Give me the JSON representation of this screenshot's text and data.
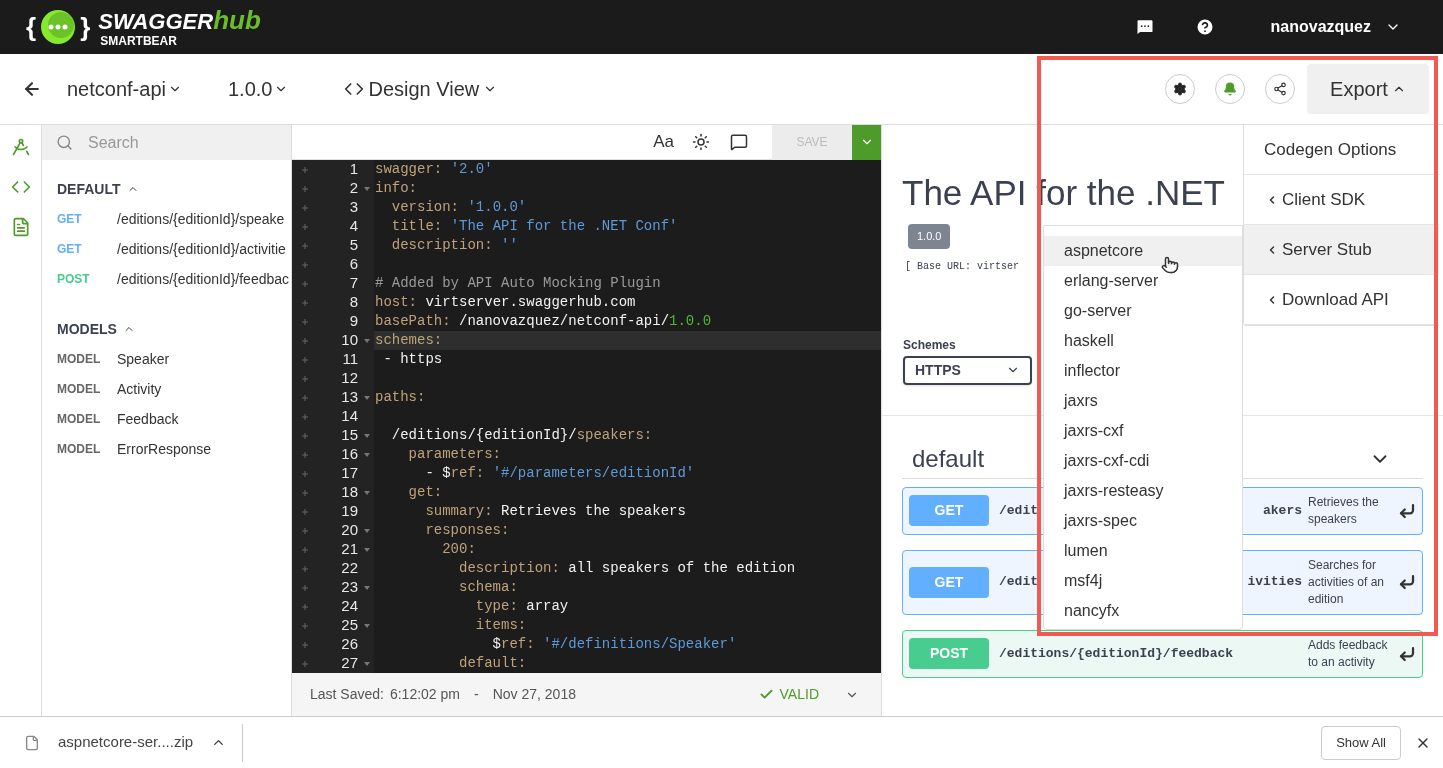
{
  "header": {
    "logo": {
      "open": "{",
      "close": "}",
      "word": "SWAGGER",
      "accent": "hub",
      "sub": "SMARTBEAR"
    },
    "user": "nanovazquez"
  },
  "toolbar": {
    "api": "netconf-api",
    "version": "1.0.0",
    "view": "Design View",
    "export": "Export"
  },
  "sidebar": {
    "search": {
      "placeholder": "Search"
    },
    "sections": [
      {
        "title": "DEFAULT",
        "expanded": true,
        "items": [
          {
            "kind": "get",
            "tag": "GET",
            "text": "/editions/{editionId}/speake"
          },
          {
            "kind": "get",
            "tag": "GET",
            "text": "/editions/{editionId}/activitie"
          },
          {
            "kind": "post",
            "tag": "POST",
            "text": "/editions/{editionId}/feedbac"
          }
        ]
      },
      {
        "title": "MODELS",
        "expanded": true,
        "items": [
          {
            "kind": "model",
            "tag": "MODEL",
            "text": "Speaker"
          },
          {
            "kind": "model",
            "tag": "MODEL",
            "text": "Activity"
          },
          {
            "kind": "model",
            "tag": "MODEL",
            "text": "Feedback"
          },
          {
            "kind": "model",
            "tag": "MODEL",
            "text": "ErrorResponse"
          }
        ]
      }
    ]
  },
  "editor": {
    "font_button": "Aa",
    "save": {
      "label": "SAVE",
      "disabled": true
    },
    "lines": [
      {
        "num": "1",
        "foldable": false,
        "active": false,
        "tokens": [
          {
            "kind": "key",
            "text": "swagger: "
          },
          {
            "kind": "string",
            "text": "'2.0'"
          }
        ]
      },
      {
        "num": "2",
        "foldable": true,
        "active": false,
        "tokens": [
          {
            "kind": "key",
            "text": "info:"
          }
        ]
      },
      {
        "num": "3",
        "foldable": false,
        "active": false,
        "tokens": [
          {
            "kind": "key",
            "text": "  version: "
          },
          {
            "kind": "string",
            "text": "'1.0.0'"
          }
        ]
      },
      {
        "num": "4",
        "foldable": false,
        "active": false,
        "tokens": [
          {
            "kind": "key",
            "text": "  title: "
          },
          {
            "kind": "string",
            "text": "'The API for the .NET Conf'"
          }
        ]
      },
      {
        "num": "5",
        "foldable": false,
        "active": false,
        "tokens": [
          {
            "kind": "key",
            "text": "  description: "
          },
          {
            "kind": "string",
            "text": "''"
          }
        ]
      },
      {
        "num": "6",
        "foldable": false,
        "active": false
      },
      {
        "num": "7",
        "foldable": false,
        "active": false,
        "tokens": [
          {
            "kind": "comment",
            "text": "# Added by API Auto Mocking Plugin"
          }
        ]
      },
      {
        "num": "8",
        "foldable": false,
        "active": false,
        "tokens": [
          {
            "kind": "key",
            "text": "host: "
          },
          {
            "kind": "plain",
            "text": "virtserver.swaggerhub.com"
          }
        ]
      },
      {
        "num": "9",
        "foldable": false,
        "active": false,
        "tokens": [
          {
            "kind": "key",
            "text": "basePath: "
          },
          {
            "kind": "plain",
            "text": "/nanovazquez/netconf-api/"
          },
          {
            "kind": "number",
            "text": "1.0.0"
          }
        ]
      },
      {
        "num": "10",
        "foldable": true,
        "active": true,
        "tokens": [
          {
            "kind": "key",
            "text": "schemes:"
          }
        ]
      },
      {
        "num": "11",
        "foldable": false,
        "active": false,
        "tokens": [
          {
            "kind": "plain",
            "text": " - https"
          }
        ]
      },
      {
        "num": "12",
        "foldable": false,
        "active": false
      },
      {
        "num": "13",
        "foldable": true,
        "active": false,
        "tokens": [
          {
            "kind": "key",
            "text": "paths:"
          }
        ]
      },
      {
        "num": "14",
        "foldable": false,
        "active": false
      },
      {
        "num": "15",
        "foldable": true,
        "active": false,
        "tokens": [
          {
            "kind": "plain",
            "text": "  /editions/{editionId}/"
          },
          {
            "kind": "key",
            "text": "speakers:"
          }
        ]
      },
      {
        "num": "16",
        "foldable": true,
        "active": false,
        "tokens": [
          {
            "kind": "key",
            "text": "    parameters:"
          }
        ]
      },
      {
        "num": "17",
        "foldable": false,
        "active": false,
        "tokens": [
          {
            "kind": "plain",
            "text": "      - $"
          },
          {
            "kind": "key",
            "text": "ref: "
          },
          {
            "kind": "string",
            "text": "'#/parameters/editionId'"
          }
        ]
      },
      {
        "num": "18",
        "foldable": true,
        "active": false,
        "tokens": [
          {
            "kind": "key",
            "text": "    get:"
          }
        ]
      },
      {
        "num": "19",
        "foldable": false,
        "active": false,
        "tokens": [
          {
            "kind": "key",
            "text": "      summary: "
          },
          {
            "kind": "plain",
            "text": "Retrieves the speakers"
          }
        ]
      },
      {
        "num": "20",
        "foldable": true,
        "active": false,
        "tokens": [
          {
            "kind": "key",
            "text": "      responses:"
          }
        ]
      },
      {
        "num": "21",
        "foldable": true,
        "active": false,
        "tokens": [
          {
            "kind": "key",
            "text": "        200:"
          }
        ]
      },
      {
        "num": "22",
        "foldable": false,
        "active": false,
        "tokens": [
          {
            "kind": "key",
            "text": "          description: "
          },
          {
            "kind": "plain",
            "text": "all speakers of the edition"
          }
        ]
      },
      {
        "num": "23",
        "foldable": true,
        "active": false,
        "tokens": [
          {
            "kind": "key",
            "text": "          schema:"
          }
        ]
      },
      {
        "num": "24",
        "foldable": false,
        "active": false,
        "tokens": [
          {
            "kind": "key",
            "text": "            type: "
          },
          {
            "kind": "plain",
            "text": "array"
          }
        ]
      },
      {
        "num": "25",
        "foldable": true,
        "active": false,
        "tokens": [
          {
            "kind": "key",
            "text": "            items:"
          }
        ]
      },
      {
        "num": "26",
        "foldable": false,
        "active": false,
        "tokens": [
          {
            "kind": "plain",
            "text": "              $"
          },
          {
            "kind": "key",
            "text": "ref: "
          },
          {
            "kind": "string",
            "text": "'#/definitions/Speaker'"
          }
        ]
      },
      {
        "num": "27",
        "foldable": true,
        "active": false,
        "tokens": [
          {
            "kind": "key",
            "text": "          default:"
          }
        ]
      }
    ],
    "status": {
      "label": "Last Saved:",
      "time": "6:12:02 pm",
      "separator": "-",
      "date": "Nov 27, 2018",
      "validity": {
        "kind": "valid",
        "text": "VALID"
      }
    }
  },
  "docs": {
    "title": "The API for the .NET",
    "version": "1.0.0",
    "base_url": "[ Base URL: virtser",
    "schemes_label": "Schemes",
    "scheme": "HTTPS",
    "section": {
      "title": "default",
      "expanded": true
    },
    "operations": [
      {
        "kind": "get",
        "method": "GET",
        "path_start": "/edit",
        "path_end": "akers",
        "description": "Retrieves the speakers"
      },
      {
        "kind": "get",
        "method": "GET",
        "path_start": "/edit",
        "path_end": "ivities",
        "description": "Searches for activities of an edition"
      },
      {
        "kind": "post",
        "method": "POST",
        "path_start": "/editions/{editionId}/feedback",
        "description": "Adds feedback to an activity"
      }
    ]
  },
  "export_menu": [
    {
      "kind": "header",
      "label": "Codegen Options",
      "selected": false
    },
    {
      "kind": "submenu",
      "label": "Client SDK",
      "selected": false
    },
    {
      "kind": "submenu",
      "label": "Server Stub",
      "selected": true
    },
    {
      "kind": "submenu",
      "label": "Download API",
      "selected": false
    }
  ],
  "server_stubs": [
    {
      "label": "aspnetcore",
      "selected": true
    },
    {
      "label": "erlang-server",
      "selected": false
    },
    {
      "label": "go-server",
      "selected": false
    },
    {
      "label": "haskell",
      "selected": false
    },
    {
      "label": "inflector",
      "selected": false
    },
    {
      "label": "jaxrs",
      "selected": false
    },
    {
      "label": "jaxrs-cxf",
      "selected": false
    },
    {
      "label": "jaxrs-cxf-cdi",
      "selected": false
    },
    {
      "label": "jaxrs-resteasy",
      "selected": false
    },
    {
      "label": "jaxrs-spec",
      "selected": false
    },
    {
      "label": "lumen",
      "selected": false
    },
    {
      "label": "msf4j",
      "selected": false
    },
    {
      "label": "nancyfx",
      "selected": false
    }
  ],
  "downloads": {
    "file": "aspnetcore-ser....zip",
    "show_all": "Show All"
  }
}
